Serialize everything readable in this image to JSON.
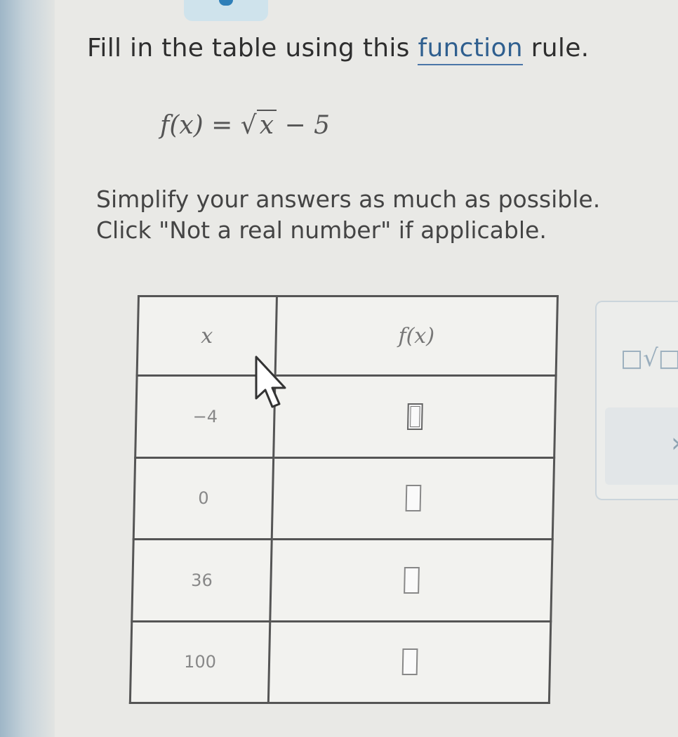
{
  "prompt": {
    "before_link": "Fill in the table using this ",
    "link": "function",
    "after_link": " rule."
  },
  "rule": {
    "lhs": "f(x) = ",
    "radical_sign": "√",
    "radicand": "x",
    "rest": " − 5"
  },
  "hint": {
    "line1": "Simplify your answers as much as possible.",
    "line2": "Click \"Not a real number\" if applicable."
  },
  "table": {
    "headers": [
      "x",
      "f(x)"
    ],
    "rows": [
      {
        "x": "−4",
        "fx": ""
      },
      {
        "x": "0",
        "fx": ""
      },
      {
        "x": "36",
        "fx": ""
      },
      {
        "x": "100",
        "fx": ""
      }
    ]
  },
  "tools": {
    "sqrt_tool": "□√□",
    "next_arrow": "›"
  },
  "icons": [
    "sqrt-tool-icon",
    "chevron-right-icon",
    "mouse-pointer-icon"
  ]
}
